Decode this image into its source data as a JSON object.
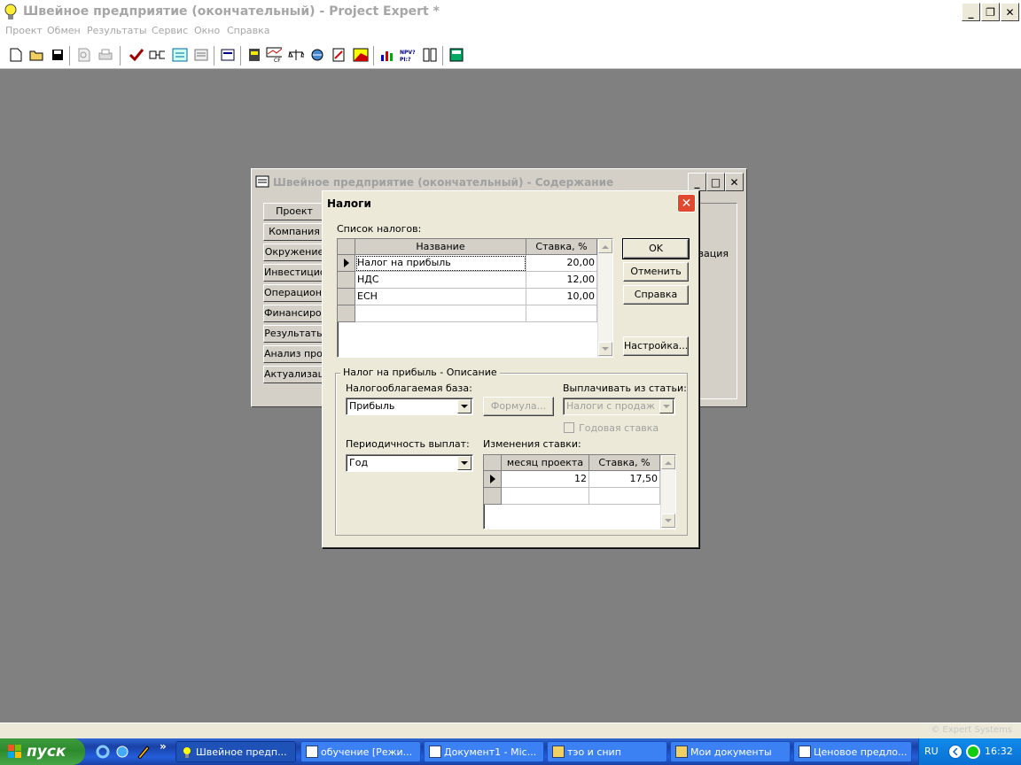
{
  "app": {
    "title": "Швейное предприятие (окончательный) - Project Expert *"
  },
  "menu": [
    "Проект",
    "Обмен",
    "Результаты",
    "Сервис",
    "Окно",
    "Справка"
  ],
  "toolbar": {
    "icons": [
      "new-icon",
      "open-icon",
      "save-icon",
      "preview-icon",
      "print-icon",
      "check-icon",
      "check-list-icon",
      "exchange-icon",
      "notes-icon",
      "screen-icon",
      "book-icon",
      "cashflow-icon",
      "balance-icon",
      "globe-icon",
      "report-icon",
      "chart-icon",
      "bar-chart-icon",
      "npv-icon",
      "compare-icon",
      "calculator-icon"
    ],
    "npv_label_top": "NPV?",
    "npv_label_bottom": "PI:?"
  },
  "bg_window": {
    "title": "Швейное предприятие (окончательный) - Содержание",
    "buttons": [
      "Проект",
      "Компания",
      "Окружение",
      "Инвестиционный план",
      "Операционный план",
      "Финансирование",
      "Результаты",
      "Анализ проекта",
      "Актуализация"
    ],
    "right_text": "изация"
  },
  "dialog": {
    "title": "Налоги",
    "list_label": "Список налогов:",
    "columns": [
      "Название",
      "Ставка, %"
    ],
    "rows": [
      {
        "name": "Налог на прибыль",
        "rate": "20,00"
      },
      {
        "name": "НДС",
        "rate": "12,00"
      },
      {
        "name": "ЕСН",
        "rate": "10,00"
      },
      {
        "name": "",
        "rate": ""
      }
    ],
    "buttons": {
      "ok": "OK",
      "cancel": "Отменить",
      "help": "Справка",
      "settings": "Настройка..."
    },
    "desc_group": "Налог на прибыль - Описание",
    "base_label": "Налогооблагаемая база:",
    "base_value": "Прибыль",
    "formula_button": "Формула...",
    "pay_from_label": "Выплачивать из статьи:",
    "pay_from_value": "Налоги с продаж",
    "annual_rate_label": "Годовая ставка",
    "period_label": "Периодичность выплат:",
    "period_value": "Год",
    "changes_label": "Изменения ставки:",
    "change_columns": [
      "месяц проекта",
      "Ставка, %"
    ],
    "change_rows": [
      {
        "month": "12",
        "rate": "17,50"
      },
      {
        "month": "",
        "rate": ""
      }
    ]
  },
  "statusbar": {
    "copyright": "© Expert Systems"
  },
  "taskbar": {
    "start": "пуск",
    "tasks": [
      "Швейное предп...",
      "обучение [Режи...",
      "Документ1 - Mic...",
      "тэо и снип",
      "Мои документы",
      "Ценовое предло..."
    ],
    "lang": "RU",
    "time": "16:32"
  }
}
